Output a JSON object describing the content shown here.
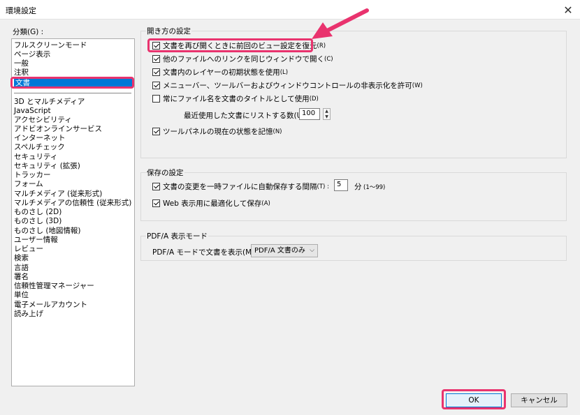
{
  "window": {
    "title": "環境設定",
    "close_symbol": "✕"
  },
  "categories": {
    "label": "分類(G) :",
    "group1": [
      "フルスクリーンモード",
      "ページ表示",
      "一般",
      "注釈",
      "文書"
    ],
    "selected": "文書",
    "group2": [
      "3D とマルチメディア",
      "JavaScript",
      "アクセシビリティ",
      "アドビオンラインサービス",
      "インターネット",
      "スペルチェック",
      "セキュリティ",
      "セキュリティ (拡張)",
      "トラッカー",
      "フォーム",
      "マルチメディア (従来形式)",
      "マルチメディアの信頼性 (従来形式)",
      "ものさし (2D)",
      "ものさし (3D)",
      "ものさし (地図情報)",
      "ユーザー情報",
      "レビュー",
      "検索",
      "言語",
      "署名",
      "信頼性管理マネージャー",
      "単位",
      "電子メールアカウント",
      "読み上げ"
    ]
  },
  "open_settings": {
    "title": "開き方の設定",
    "options": [
      {
        "label": "文書を再び開くときに前回のビュー設定を復元",
        "shortcut": "(R)",
        "checked": true
      },
      {
        "label": "他のファイルへのリンクを同じウィンドウで開く",
        "shortcut": "(C)",
        "checked": true
      },
      {
        "label": "文書内のレイヤーの初期状態を使用",
        "shortcut": "(L)",
        "checked": true
      },
      {
        "label": "メニューバー、ツールバーおよびウィンドウコントロールの非表示化を許可",
        "shortcut": "(W)",
        "checked": true
      },
      {
        "label": "常にファイル名を文書のタイトルとして使用",
        "shortcut": "(D)",
        "checked": false
      }
    ],
    "recent_label": "最近使用した文書にリストする数(U) :",
    "recent_value": "100",
    "tool_panel": {
      "label": "ツールパネルの現在の状態を記憶",
      "shortcut": "(N)",
      "checked": true
    }
  },
  "save_settings": {
    "title": "保存の設定",
    "autosave": {
      "label": "文書の変更を一時ファイルに自動保存する間隔",
      "shortcut": "(T) :",
      "checked": true
    },
    "autosave_value": "5",
    "autosave_unit": "分",
    "autosave_range": "(1〜99)",
    "web_optimize": {
      "label": "Web 表示用に最適化して保存",
      "shortcut": "(A)",
      "checked": true
    }
  },
  "pdfa": {
    "title": "PDF/A 表示モード",
    "label": "PDF/A モードで文書を表示(M) :",
    "selected": "PDF/A 文書のみ"
  },
  "buttons": {
    "ok": "OK",
    "cancel": "キャンセル"
  },
  "annotation_color": "#e9336e",
  "selection_color": "#0078d7"
}
